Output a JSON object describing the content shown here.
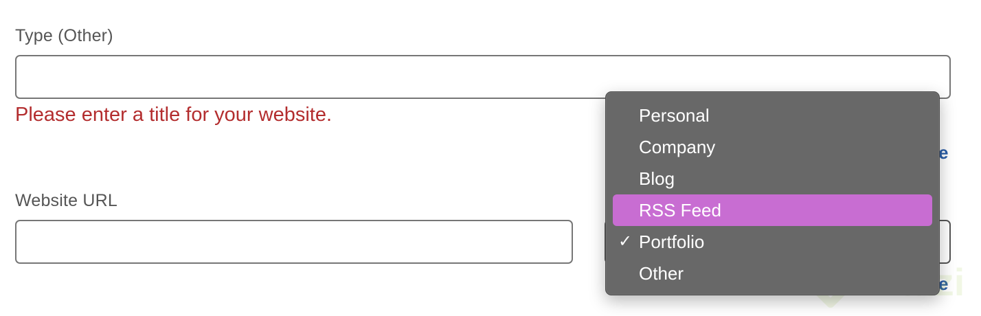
{
  "form": {
    "type_other_label": "Type (Other)",
    "type_other_value": "",
    "error_message": "Please enter a title for your website.",
    "website_url_label": "Website URL",
    "website_url_value": "",
    "link_fragment_1": "e",
    "link_fragment_2": "e"
  },
  "dropdown": {
    "items": [
      {
        "label": "Personal",
        "checked": false,
        "highlighted": false
      },
      {
        "label": "Company",
        "checked": false,
        "highlighted": false
      },
      {
        "label": "Blog",
        "checked": false,
        "highlighted": false
      },
      {
        "label": "RSS Feed",
        "checked": false,
        "highlighted": true
      },
      {
        "label": "Portfolio",
        "checked": true,
        "highlighted": false
      },
      {
        "label": "Other",
        "checked": false,
        "highlighted": false
      }
    ],
    "check_glyph": "✓"
  },
  "watermark": {
    "text": "Platzi"
  },
  "colors": {
    "error": "#b32d2e",
    "menu_background": "#686868",
    "menu_highlight": "#c86dd2",
    "link": "#2a5ea8",
    "watermark": "#98ca3f"
  }
}
